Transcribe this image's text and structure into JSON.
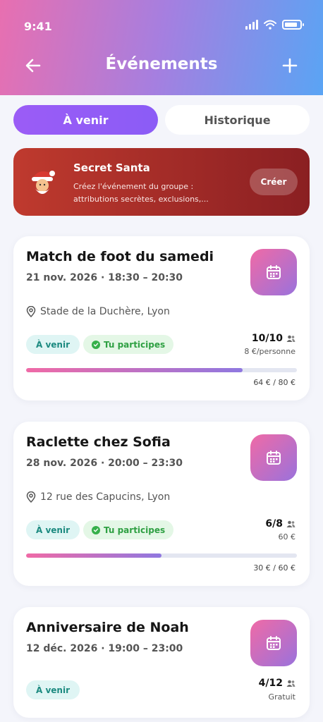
{
  "status": {
    "time": "9:41"
  },
  "header": {
    "title": "Événements"
  },
  "tabs": [
    {
      "label": "À venir",
      "active": true
    },
    {
      "label": "Historique",
      "active": false
    }
  ],
  "santa": {
    "title": "Secret Santa",
    "description": "Créez l'événement du groupe : attributions secrètes, exclusions,...",
    "button": "Créer"
  },
  "events": [
    {
      "title": "Match de foot du samedi",
      "date": "21 nov. 2026 · 18:30 – 20:30",
      "location": "Stade de la Duchère, Lyon",
      "status": "À venir",
      "participation": "Tu participes",
      "count": "10/10",
      "price": "8 €/personne",
      "progress": 0.8,
      "amount": "64 € / 80 €"
    },
    {
      "title": "Raclette chez Sofia",
      "date": "28 nov. 2026 · 20:00 – 23:30",
      "location": "12 rue des Capucins, Lyon",
      "status": "À venir",
      "participation": "Tu participes",
      "count": "6/8",
      "price": "60 €",
      "progress": 0.5,
      "amount": "30 € / 60 €"
    },
    {
      "title": "Anniversaire de Noah",
      "date": "12 déc. 2026 · 19:00 – 23:00",
      "status": "À venir",
      "count": "4/12",
      "price": "Gratuit"
    }
  ],
  "colors": {
    "primary": "#8b5cf6",
    "santa": "#a72b27",
    "upcoming": "#1c8a80",
    "participating": "#2fa043"
  }
}
